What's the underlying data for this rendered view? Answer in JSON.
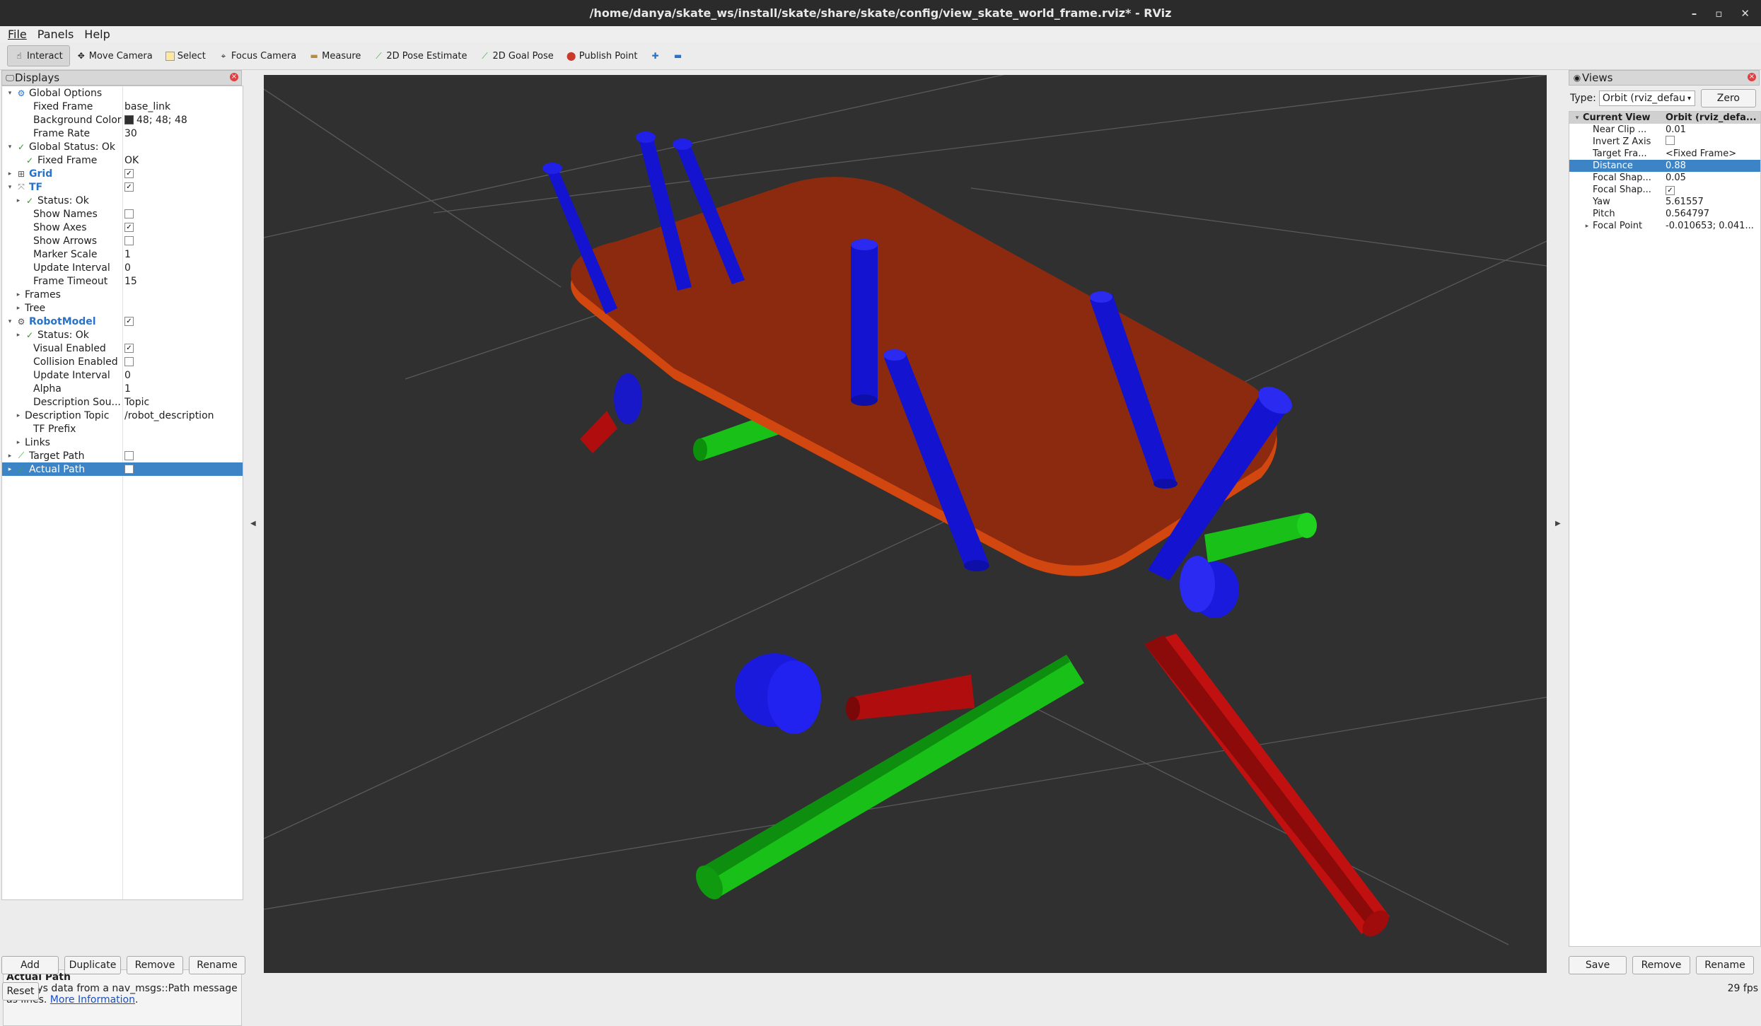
{
  "window": {
    "title": "/home/danya/skate_ws/install/skate/share/skate/config/view_skate_world_frame.rviz* - RViz",
    "controls": [
      "–",
      "▫",
      "✕"
    ]
  },
  "menu": [
    "File",
    "Panels",
    "Help"
  ],
  "toolbar": [
    {
      "label": "Interact",
      "icon": "hand-icon"
    },
    {
      "label": "Move Camera",
      "icon": "move-camera-icon"
    },
    {
      "label": "Select",
      "icon": "select-icon"
    },
    {
      "label": "Focus Camera",
      "icon": "focus-camera-icon"
    },
    {
      "label": "Measure",
      "icon": "measure-icon"
    },
    {
      "label": "2D Pose Estimate",
      "icon": "pose-estimate-icon"
    },
    {
      "label": "2D Goal Pose",
      "icon": "goal-pose-icon"
    },
    {
      "label": "Publish Point",
      "icon": "publish-point-icon"
    }
  ],
  "displays": {
    "title": "Displays",
    "rows": [
      {
        "name": "Global Options",
        "value": "",
        "indent": 0,
        "arrow": "▾",
        "icon": "gear"
      },
      {
        "name": "Fixed Frame",
        "value": "base_link",
        "indent": 2
      },
      {
        "name": "Background Color",
        "value": "48; 48; 48",
        "indent": 2,
        "swatch": true
      },
      {
        "name": "Frame Rate",
        "value": "30",
        "indent": 2
      },
      {
        "name": "Global Status: Ok",
        "value": "",
        "indent": 0,
        "arrow": "▾",
        "icon": "check"
      },
      {
        "name": "Fixed Frame",
        "value": "OK",
        "indent": 1,
        "icon": "check"
      },
      {
        "name": "Grid",
        "value": "",
        "indent": 0,
        "arrow": "▸",
        "icon": "grid",
        "blue": true,
        "check": "✓"
      },
      {
        "name": "TF",
        "value": "",
        "indent": 0,
        "arrow": "▾",
        "icon": "tf",
        "blue": true,
        "check": "✓"
      },
      {
        "name": "Status: Ok",
        "value": "",
        "indent": 1,
        "arrow": "▸",
        "icon": "check"
      },
      {
        "name": "Show Names",
        "value": "",
        "indent": 2,
        "check": ""
      },
      {
        "name": "Show Axes",
        "value": "",
        "indent": 2,
        "check": "✓"
      },
      {
        "name": "Show Arrows",
        "value": "",
        "indent": 2,
        "check": ""
      },
      {
        "name": "Marker Scale",
        "value": "1",
        "indent": 2
      },
      {
        "name": "Update Interval",
        "value": "0",
        "indent": 2
      },
      {
        "name": "Frame Timeout",
        "value": "15",
        "indent": 2
      },
      {
        "name": "Frames",
        "value": "",
        "indent": 1,
        "arrow": "▸"
      },
      {
        "name": "Tree",
        "value": "",
        "indent": 1,
        "arrow": "▸"
      },
      {
        "name": "RobotModel",
        "value": "",
        "indent": 0,
        "arrow": "▾",
        "icon": "robot",
        "blue": true,
        "check": "✓"
      },
      {
        "name": "Status: Ok",
        "value": "",
        "indent": 1,
        "arrow": "▸",
        "icon": "check"
      },
      {
        "name": "Visual Enabled",
        "value": "",
        "indent": 2,
        "check": "✓"
      },
      {
        "name": "Collision Enabled",
        "value": "",
        "indent": 2,
        "check": ""
      },
      {
        "name": "Update Interval",
        "value": "0",
        "indent": 2
      },
      {
        "name": "Alpha",
        "value": "1",
        "indent": 2
      },
      {
        "name": "Description Sou...",
        "value": "Topic",
        "indent": 2
      },
      {
        "name": "Description Topic",
        "value": "/robot_description",
        "indent": 1,
        "arrow": "▸"
      },
      {
        "name": "TF Prefix",
        "value": "",
        "indent": 2
      },
      {
        "name": "Links",
        "value": "",
        "indent": 1,
        "arrow": "▸"
      },
      {
        "name": "Target Path",
        "value": "",
        "indent": 0,
        "arrow": "▸",
        "icon": "path",
        "check": ""
      },
      {
        "name": "Actual Path",
        "value": "",
        "indent": 0,
        "arrow": "▸",
        "icon": "path",
        "check": "",
        "selected": true
      }
    ],
    "description_title": "Actual Path",
    "description_text": "Displays data from a nav_msgs::Path message as lines.",
    "description_link": "More Information",
    "description_end": ".",
    "buttons": [
      "Add",
      "Duplicate",
      "Remove",
      "Rename"
    ]
  },
  "views": {
    "title": "Views",
    "type_label": "Type:",
    "type_value": "Orbit (rviz_defau",
    "zero": "Zero",
    "header": {
      "name": "Current View",
      "value": "Orbit (rviz_defa..."
    },
    "rows": [
      {
        "name": "Near Clip ...",
        "value": "0.01"
      },
      {
        "name": "Invert Z Axis",
        "value": "",
        "check": ""
      },
      {
        "name": "Target Fra...",
        "value": "<Fixed Frame>"
      },
      {
        "name": "Distance",
        "value": "0.88",
        "selected": true
      },
      {
        "name": "Focal Shap...",
        "value": "0.05"
      },
      {
        "name": "Focal Shap...",
        "value": "",
        "check": "✓"
      },
      {
        "name": "Yaw",
        "value": "5.61557"
      },
      {
        "name": "Pitch",
        "value": "0.564797"
      },
      {
        "name": "Focal Point",
        "value": "-0.010653; 0.041...",
        "arrow": "▸"
      }
    ],
    "buttons": [
      "Save",
      "Remove",
      "Rename"
    ]
  },
  "status": {
    "reset": "Reset",
    "fps": "29 fps"
  },
  "colors": {
    "board": "#8b2a0e",
    "board_edge": "#d2460f",
    "x_axis": "#c01010",
    "y_axis": "#10b010",
    "z_axis": "#1414d0",
    "background": "#303030"
  }
}
